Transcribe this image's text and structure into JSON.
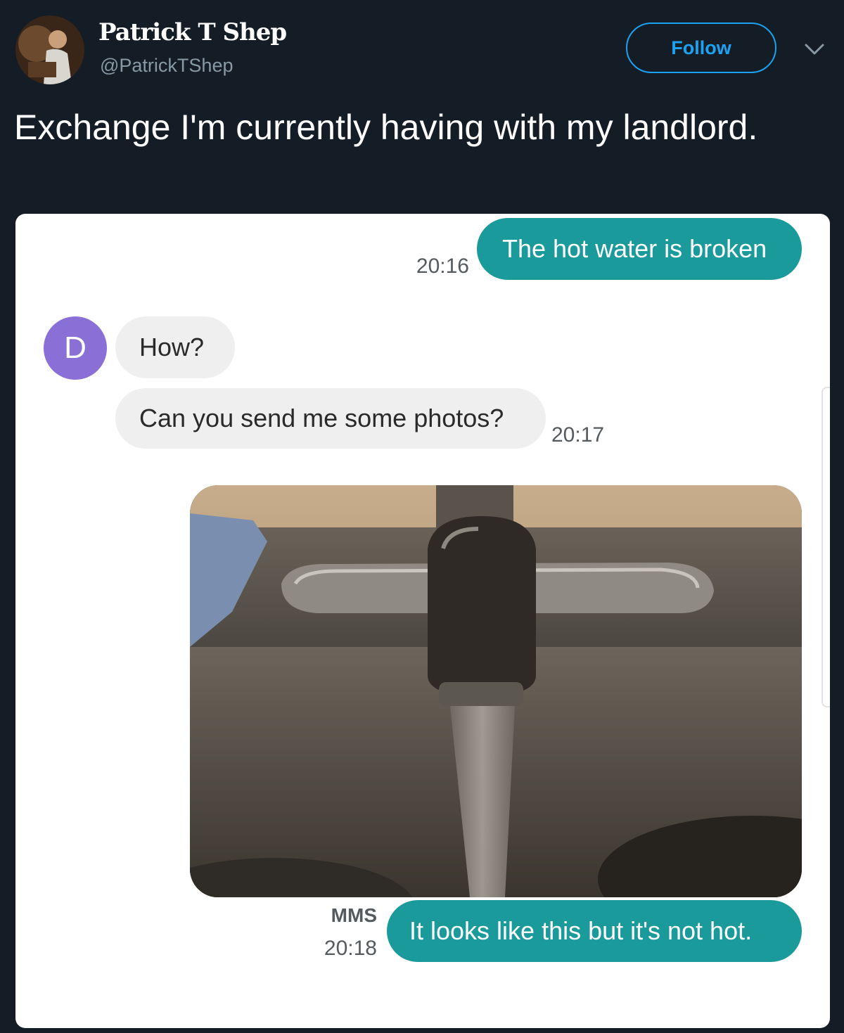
{
  "tweet": {
    "author": {
      "name": "Patrick T Shep",
      "handle": "@PatrickTShep"
    },
    "follow_label": "Follow",
    "text": "Exchange I'm currently having with my landlord."
  },
  "conversation": {
    "contact_initial": "D",
    "messages": [
      {
        "direction": "outgoing",
        "text": "The hot water is broken",
        "time": "20:16"
      },
      {
        "direction": "incoming",
        "text": "How?"
      },
      {
        "direction": "incoming",
        "text": "Can you send me some photos?",
        "time": "20:17"
      },
      {
        "direction": "outgoing",
        "type": "mms",
        "label": "MMS",
        "text": "It looks like this but it's not hot.",
        "time": "20:18"
      }
    ]
  },
  "colors": {
    "background": "#141d26",
    "accent_blue": "#1da1f2",
    "outgoing_bubble": "#1a9a9b",
    "incoming_bubble": "#efefef",
    "contact_avatar": "#8a6fd6"
  },
  "icons": {
    "menu": "chevron-down-icon",
    "contact": "contact-avatar"
  }
}
